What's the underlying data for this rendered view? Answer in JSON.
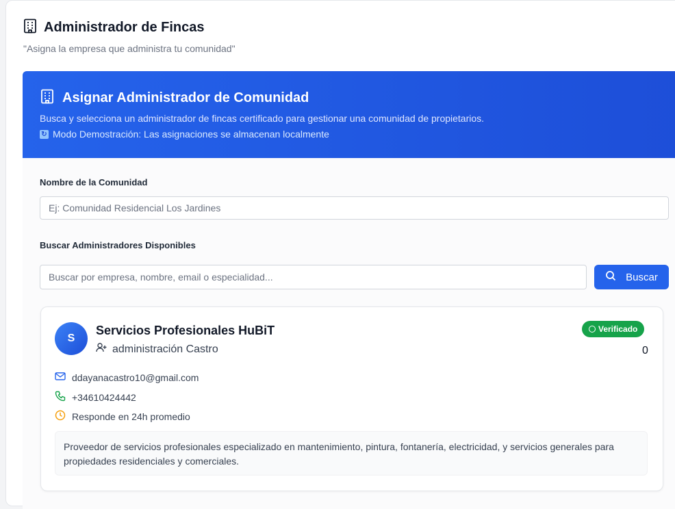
{
  "page": {
    "title": "Administrador de Fincas",
    "subtitle": "\"Asigna la empresa que administra tu comunidad\""
  },
  "banner": {
    "title": "Asignar Administrador de Comunidad",
    "description": "Busca y selecciona un administrador de fincas certificado para gestionar una comunidad de propietarios.",
    "demo_notice": "Modo Demostración: Las asignaciones se almacenan localmente"
  },
  "form": {
    "community_label": "Nombre de la Comunidad",
    "community_placeholder": "Ej: Comunidad Residencial Los Jardines",
    "community_value": "",
    "search_label": "Buscar Administradores Disponibles",
    "search_placeholder": "Buscar por empresa, nombre, email o especialidad...",
    "search_value": "",
    "search_button": "Buscar"
  },
  "result": {
    "avatar_initial": "S",
    "company": "Servicios Profesionales HuBiT",
    "administrator": "administración Castro",
    "badge": "Verificado",
    "count": "0",
    "email": "ddayanacastro10@gmail.com",
    "phone": "+34610424442",
    "response_time": "Responde en 24h promedio",
    "description": "Proveedor de servicios profesionales especializado en mantenimiento, pintura, fontanería, electricidad, y servicios generales para propiedades residenciales y comerciales."
  },
  "colors": {
    "accent": "#2563eb",
    "success": "#16a34a",
    "warning": "#f59e0b"
  },
  "icons": {
    "page": "building-icon",
    "banner": "building-icon",
    "search": "search-icon",
    "admin": "user-plus-icon",
    "email": "mail-icon",
    "phone": "phone-icon",
    "clock": "clock-icon"
  }
}
